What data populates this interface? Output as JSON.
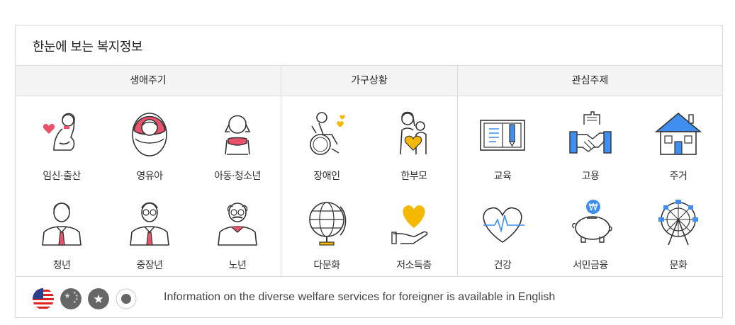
{
  "panel": {
    "title": "한눈에 보는 복지정보"
  },
  "columns": [
    "생애주기",
    "가구상황",
    "관심주제"
  ],
  "tiles": [
    {
      "label": "임신·출산",
      "icon": "pregnant-woman-icon"
    },
    {
      "label": "영유아",
      "icon": "swaddled-baby-icon"
    },
    {
      "label": "아동·청소년",
      "icon": "child-girl-icon"
    },
    {
      "label": "장애인",
      "icon": "wheelchair-person-icon"
    },
    {
      "label": "한부모",
      "icon": "parent-and-child-icon"
    },
    {
      "label": "교육",
      "icon": "book-and-pencil-icon"
    },
    {
      "label": "고용",
      "icon": "handshake-building-icon"
    },
    {
      "label": "주거",
      "icon": "house-icon"
    },
    {
      "label": "청년",
      "icon": "young-man-icon"
    },
    {
      "label": "중장년",
      "icon": "middle-aged-man-icon"
    },
    {
      "label": "노년",
      "icon": "elderly-man-icon"
    },
    {
      "label": "다문화",
      "icon": "globe-icon"
    },
    {
      "label": "저소득층",
      "icon": "hand-holding-heart-icon"
    },
    {
      "label": "건강",
      "icon": "heartbeat-icon"
    },
    {
      "label": "서민금융",
      "icon": "piggy-bank-won-icon"
    },
    {
      "label": "문화",
      "icon": "ferris-wheel-icon"
    }
  ],
  "footer": {
    "languages": [
      "us-flag-icon",
      "china-flag-icon",
      "vietnam-flag-icon",
      "japan-flag-icon"
    ],
    "text": "Information on the diverse welfare services for foreigner is available in English"
  },
  "colors": {
    "accent_pink": "#e8536b",
    "accent_yellow": "#f5b800",
    "accent_blue": "#3f8ef0",
    "line": "#333333"
  }
}
